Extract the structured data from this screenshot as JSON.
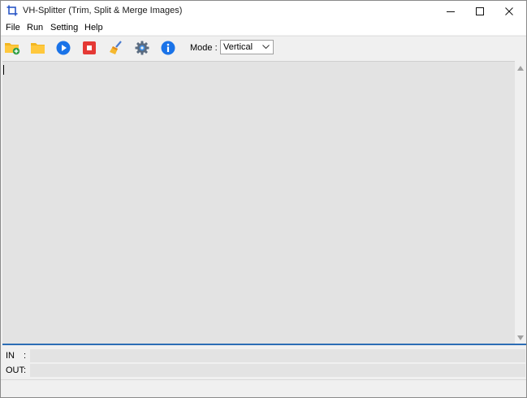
{
  "window": {
    "title": "VH-Splitter (Trim, Split & Merge Images)",
    "controls": [
      "minimize",
      "maximize",
      "close"
    ]
  },
  "menu": {
    "items": [
      "File",
      "Run",
      "Setting",
      "Help"
    ]
  },
  "toolbar": {
    "buttons": [
      {
        "icon": "add-folder-icon"
      },
      {
        "icon": "folder-icon"
      },
      {
        "icon": "play-icon"
      },
      {
        "icon": "stop-icon"
      },
      {
        "icon": "broom-icon"
      },
      {
        "icon": "gear-icon"
      },
      {
        "icon": "info-icon"
      }
    ],
    "mode_label": "Mode :",
    "mode_value": "Vertical"
  },
  "io": {
    "in_label": "IN",
    "out_label": "OUT",
    "colon": ":"
  },
  "colors": {
    "accent_divider": "#2c6db5",
    "log_background": "#e3e3e3"
  }
}
